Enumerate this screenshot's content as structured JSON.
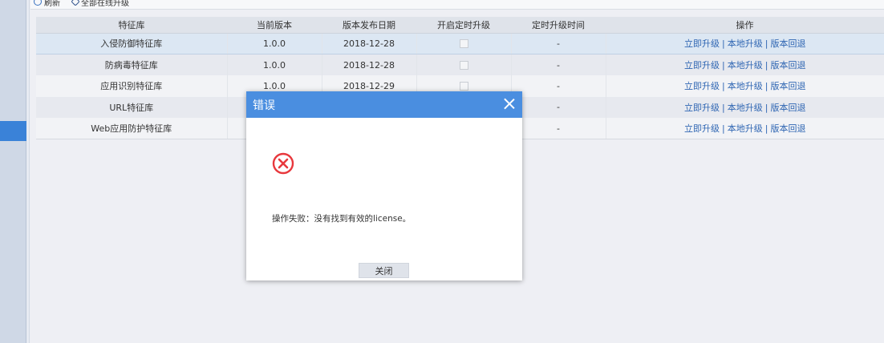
{
  "toolbar": {
    "refresh_label": "刷新",
    "upgrade_all_label": "全部在线升级"
  },
  "table": {
    "headers": [
      "特征库",
      "当前版本",
      "版本发布日期",
      "开启定时升级",
      "定时升级时间",
      "操作"
    ],
    "rows": [
      {
        "name": "入侵防御特征库",
        "version": "1.0.0",
        "date": "2018-12-28",
        "schedule_time": "-"
      },
      {
        "name": "防病毒特征库",
        "version": "1.0.0",
        "date": "2018-12-28",
        "schedule_time": "-"
      },
      {
        "name": "应用识别特征库",
        "version": "1.0.0",
        "date": "2018-12-29",
        "schedule_time": "-"
      },
      {
        "name": "URL特征库",
        "version": "",
        "date": "",
        "schedule_time": "-"
      },
      {
        "name": "Web应用防护特征库",
        "version": "",
        "date": "",
        "schedule_time": "-"
      }
    ],
    "actions": {
      "online_upgrade": "立即升级",
      "local_upgrade": "本地升级",
      "rollback": "版本回退",
      "separator": "|"
    }
  },
  "dialog": {
    "title": "错误",
    "message": "操作失败：没有找到有效的license。",
    "close_button": "关闭",
    "icon": "error-circle-icon",
    "header_color": "#4a8ee0",
    "icon_color": "#e8383d"
  }
}
